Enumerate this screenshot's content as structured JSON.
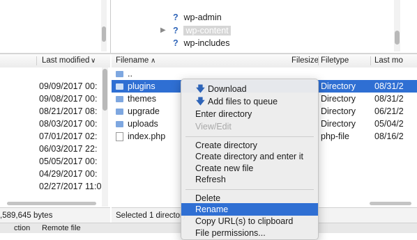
{
  "remote_tree": {
    "items": [
      {
        "label": "wp-admin"
      },
      {
        "label": "wp-content"
      },
      {
        "label": "wp-includes"
      }
    ]
  },
  "left_pane": {
    "header_last_modified": "Last modified",
    "dates": [
      "09/09/2017 00:",
      "09/08/2017 00:",
      "08/21/2017 08:",
      "08/03/2017 00:",
      "07/01/2017 02:",
      "06/03/2017 22:",
      "05/05/2017 00:",
      "04/29/2017 00:",
      "02/27/2017 11:0"
    ],
    "status": ",589,645 bytes"
  },
  "right_pane": {
    "headers": {
      "filename": "Filename",
      "filesize": "Filesize",
      "filetype": "Filetype",
      "last_modified": "Last mo"
    },
    "rows": [
      {
        "name": "..",
        "type": "",
        "date": ""
      },
      {
        "name": "plugins",
        "type": "Directory",
        "date": "08/31/2"
      },
      {
        "name": "themes",
        "type": "Directory",
        "date": "08/31/2"
      },
      {
        "name": "upgrade",
        "type": "Directory",
        "date": "06/21/2"
      },
      {
        "name": "uploads",
        "type": "Directory",
        "date": "05/04/2"
      },
      {
        "name": "index.php",
        "type": "php-file",
        "date": "08/16/2"
      }
    ],
    "status": "Selected 1 directory."
  },
  "bottom_strip": {
    "col1": "ction",
    "col2": "Remote file"
  },
  "context_menu": {
    "download": "Download",
    "add_to_queue": "Add files to queue",
    "enter_directory": "Enter directory",
    "view_edit": "View/Edit",
    "create_directory": "Create directory",
    "create_directory_enter": "Create directory and enter it",
    "create_new_file": "Create new file",
    "refresh": "Refresh",
    "delete": "Delete",
    "rename": "Rename",
    "copy_urls": "Copy URL(s) to clipboard",
    "file_permissions": "File permissions..."
  },
  "colors": {
    "selection": "#2f6fd3",
    "folder": "#7ea7e0",
    "accent_icon": "#2e64b8"
  }
}
